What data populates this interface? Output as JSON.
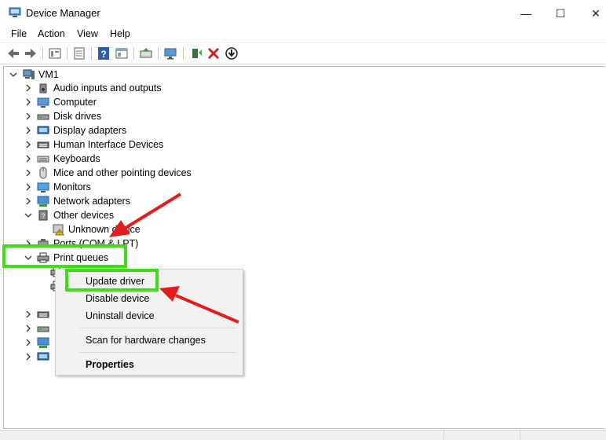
{
  "window": {
    "title": "Device Manager",
    "minimize": "—",
    "maximize": "☐",
    "close": "✕"
  },
  "menu": [
    "File",
    "Action",
    "View",
    "Help"
  ],
  "toolbar_icons": [
    "back-icon",
    "forward-icon",
    "properties-icon",
    "list-icon",
    "help-icon",
    "details-icon",
    "update-icon",
    "monitor-icon",
    "enable-device-icon",
    "uninstall-icon",
    "download-icon"
  ],
  "tree": {
    "root": "VM1",
    "items": [
      {
        "label": "Audio inputs and outputs",
        "icon": "speaker-icon",
        "expanded": false
      },
      {
        "label": "Computer",
        "icon": "computer-icon",
        "expanded": false
      },
      {
        "label": "Disk drives",
        "icon": "disk-icon",
        "expanded": false
      },
      {
        "label": "Display adapters",
        "icon": "display-adapter-icon",
        "expanded": false
      },
      {
        "label": "Human Interface Devices",
        "icon": "hid-icon",
        "expanded": false
      },
      {
        "label": "Keyboards",
        "icon": "keyboard-icon",
        "expanded": false
      },
      {
        "label": "Mice and other pointing devices",
        "icon": "mouse-icon",
        "expanded": false
      },
      {
        "label": "Monitors",
        "icon": "monitor-icon",
        "expanded": false
      },
      {
        "label": "Network adapters",
        "icon": "network-icon",
        "expanded": false
      },
      {
        "label": "Other devices",
        "icon": "other-devices-icon",
        "expanded": true
      },
      {
        "label": "Unknown device",
        "icon": "warning-device-icon",
        "child": true
      },
      {
        "label": "Ports (COM & LPT)",
        "icon": "port-icon",
        "expanded": false
      },
      {
        "label": "Print queues",
        "icon": "printer-icon",
        "expanded": true
      }
    ]
  },
  "context_menu": {
    "items": [
      "Update driver",
      "Disable device",
      "Uninstall device"
    ],
    "scan": "Scan for hardware changes",
    "properties": "Properties"
  },
  "annotation_colors": {
    "highlight": "#3fdc17",
    "arrow": "#e21b1b"
  }
}
